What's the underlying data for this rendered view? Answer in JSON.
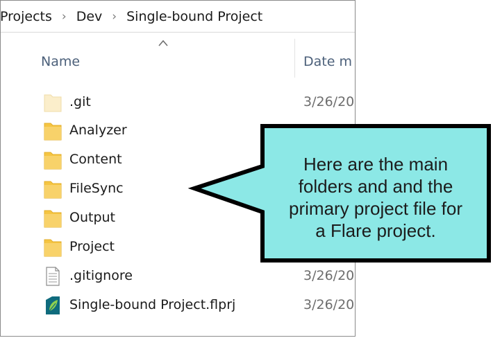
{
  "address_bar": {
    "crumbs": [
      "Projects",
      "Dev",
      "Single-bound Project"
    ]
  },
  "columns": {
    "name": "Name",
    "date": "Date m"
  },
  "files": [
    {
      "name": ".git",
      "date": "3/26/20",
      "icon": "folder-hidden-icon"
    },
    {
      "name": "Analyzer",
      "date": "",
      "icon": "folder-icon"
    },
    {
      "name": "Content",
      "date": "",
      "icon": "folder-icon"
    },
    {
      "name": "FileSync",
      "date": "",
      "icon": "folder-icon"
    },
    {
      "name": "Output",
      "date": "",
      "icon": "folder-icon"
    },
    {
      "name": "Project",
      "date": "",
      "icon": "folder-icon"
    },
    {
      "name": ".gitignore",
      "date": "3/26/20",
      "icon": "text-file-icon"
    },
    {
      "name": "Single-bound Project.flprj",
      "date": "3/26/20",
      "icon": "flare-project-icon"
    }
  ],
  "callout": {
    "text_lines": [
      "Here are the main",
      "folders and and the",
      "primary project file for",
      "a Flare project."
    ],
    "fill": "#8ce8e6",
    "stroke": "#000000"
  },
  "colors": {
    "folder": "#f5c542",
    "header_text": "#4c607a"
  }
}
